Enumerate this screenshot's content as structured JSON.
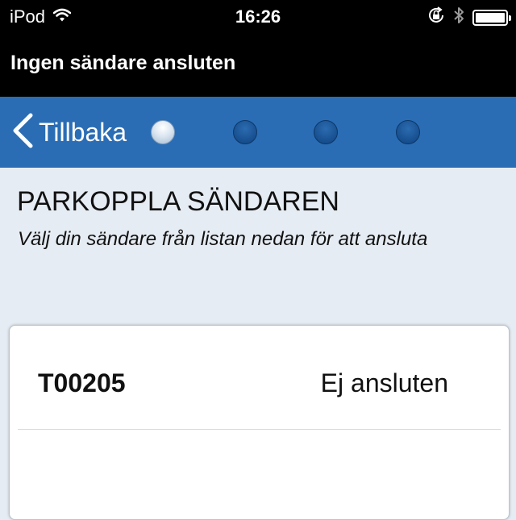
{
  "status_bar": {
    "carrier": "iPod",
    "time": "16:26",
    "icons": [
      "wifi-icon",
      "rotation-lock-icon",
      "bluetooth-icon",
      "battery-icon"
    ]
  },
  "app_bar": {
    "title": "Ingen sändare ansluten"
  },
  "nav": {
    "back_label": "Tillbaka",
    "steps_total": 4,
    "current_step": 1
  },
  "content": {
    "title": "PARKOPPLA SÄNDAREN",
    "subtitle": "Välj din sändare från listan nedan för att ansluta"
  },
  "devices": [
    {
      "id": "T00205",
      "status": "Ej ansluten"
    }
  ],
  "colors": {
    "nav_background": "#2a6db5",
    "page_background": "#e6ecf3",
    "bars_background": "#000000"
  }
}
